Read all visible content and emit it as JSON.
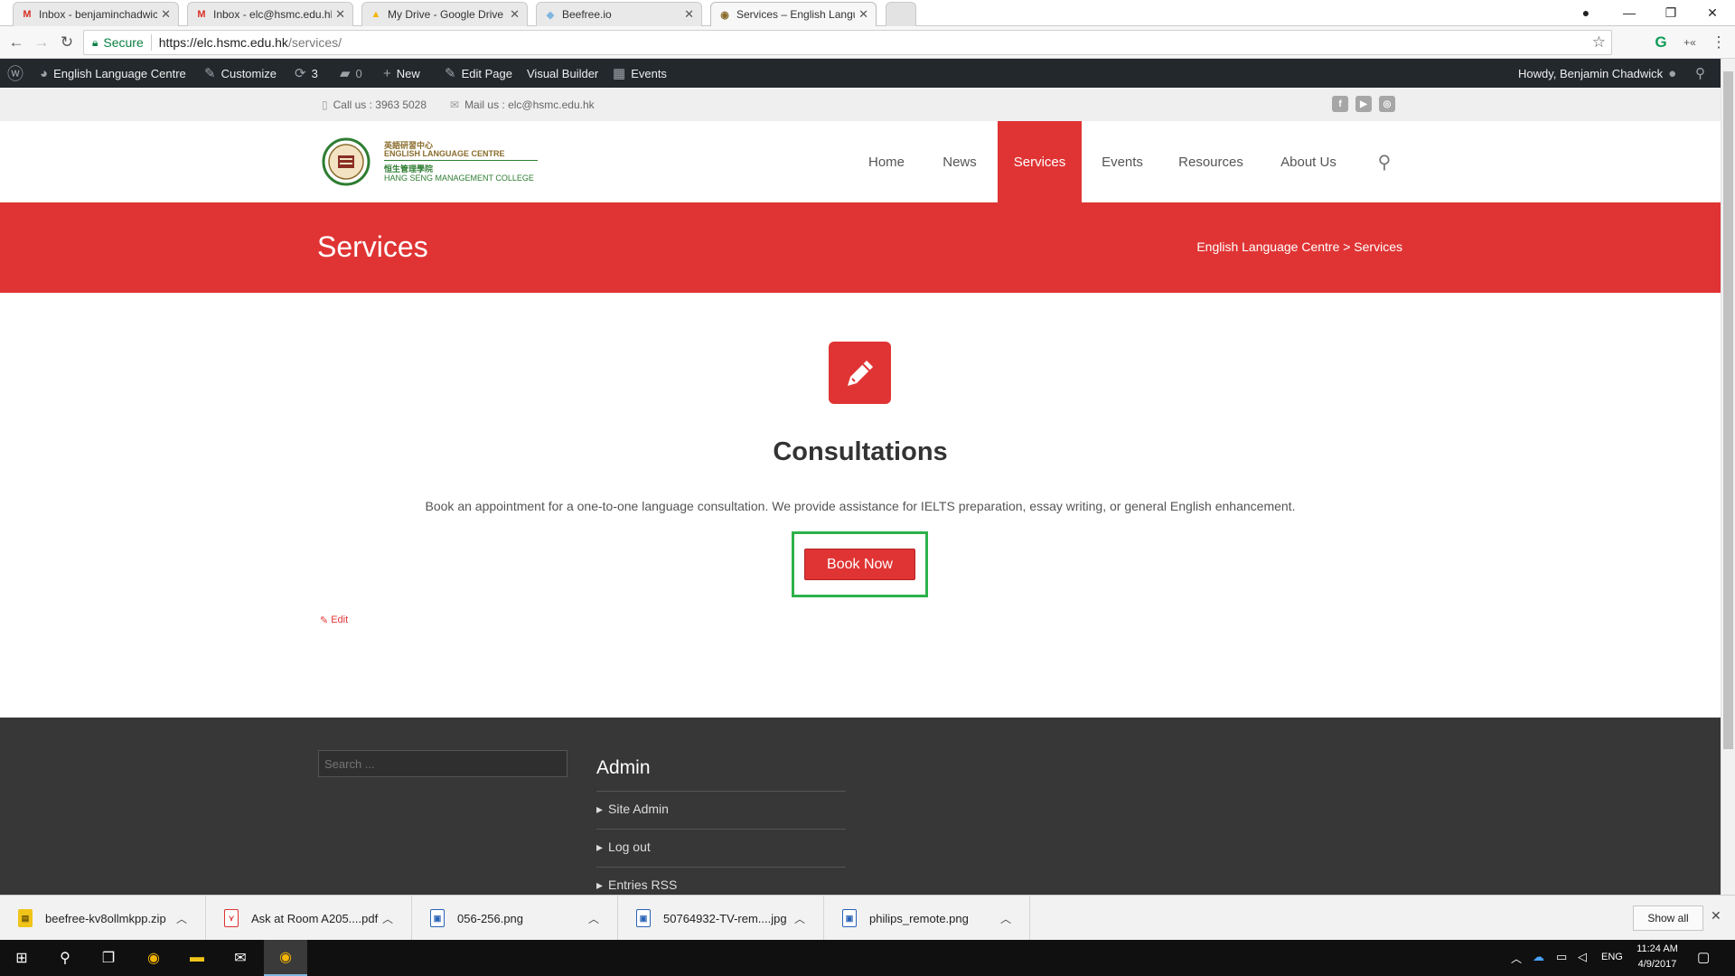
{
  "browser": {
    "tabs": [
      {
        "title": "Inbox - benjaminchadwick",
        "icon": "gmail-icon"
      },
      {
        "title": "Inbox - elc@hsmc.edu.hk",
        "icon": "gmail-icon"
      },
      {
        "title": "My Drive - Google Drive",
        "icon": "google-drive-icon"
      },
      {
        "title": "Beefree.io",
        "icon": "beefree-icon"
      },
      {
        "title": "Services – English Langu",
        "icon": "site-favicon",
        "active": true
      }
    ],
    "secure_label": "Secure",
    "url_host": "https://elc.hsmc.edu.hk",
    "url_path": "/services/"
  },
  "adminbar": {
    "site_name": "English Language Centre",
    "customize": "Customize",
    "updates_count": "3",
    "comments_count": "0",
    "new": "New",
    "edit_page": "Edit Page",
    "visual_builder": "Visual Builder",
    "events": "Events",
    "howdy": "Howdy, Benjamin Chadwick"
  },
  "infobar": {
    "phone": "Call us : 3963 5028",
    "mail": "Mail us : elc@hsmc.edu.hk",
    "social": [
      "f",
      "▶",
      "◎"
    ]
  },
  "logo": {
    "chinese_1": "英語研習中心",
    "english_1": "ENGLISH LANGUAGE CENTRE",
    "chinese_2": "恒生管理學院",
    "english_2": "HANG SENG MANAGEMENT COLLEGE"
  },
  "nav": {
    "items": [
      "Home",
      "News",
      "Services",
      "Events",
      "Resources",
      "About Us"
    ],
    "active": "Services"
  },
  "page_title": "Services",
  "breadcrumb": "English Language Centre > Services",
  "service": {
    "heading": "Consultations",
    "description": "Book an appointment for a one-to-one language consultation. We provide assistance for IELTS preparation, essay writing, or general English enhancement.",
    "button": "Book Now"
  },
  "edit_link": "Edit",
  "footer": {
    "search_placeholder": "Search ...",
    "admin_heading": "Admin",
    "admin_links": [
      "Site Admin",
      "Log out",
      "Entries RSS"
    ]
  },
  "downloads": [
    {
      "name": "beefree-kv8ollmkpp.zip",
      "type": "zip"
    },
    {
      "name": "Ask at Room A205....pdf",
      "type": "pdf"
    },
    {
      "name": "056-256.png",
      "type": "png"
    },
    {
      "name": "50764932-TV-rem....jpg",
      "type": "jpg"
    },
    {
      "name": "philips_remote.png",
      "type": "png"
    }
  ],
  "show_all": "Show all",
  "taskbar": {
    "language": "ENG",
    "time": "11:24 AM",
    "date": "4/9/2017"
  },
  "colors": {
    "accent_red": "#e03434",
    "admin_bar": "#23282d",
    "footer_bg": "#373737",
    "highlight_green": "#2db14a"
  }
}
